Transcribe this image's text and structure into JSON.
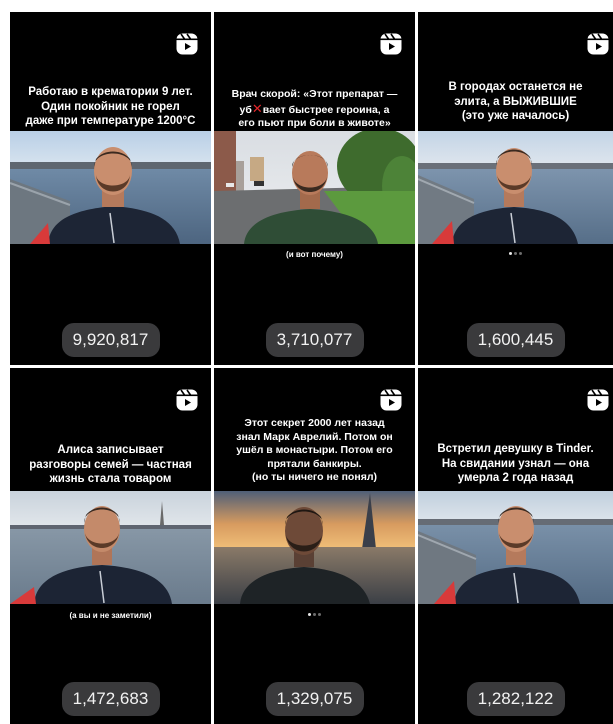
{
  "reels": [
    {
      "caption": "Работаю в крематории 9 лет.\nОдин покойник не горел\nдаже при температуре 1200°C",
      "views": "9,920,817"
    },
    {
      "caption_part1": "Врач скорой: «Этот препарат —\nуб",
      "caption_mark": "✕",
      "caption_part2": "вает быстрее героина, а\nего пьют при боли в животе»",
      "subtext": "(и вот почему)",
      "views": "3,710,077"
    },
    {
      "caption": "В городах останется не\nэлита, а ВЫЖИВШИЕ\n(это уже началось)",
      "views": "1,600,445"
    },
    {
      "caption": "Алиса записывает\nразговоры семей — частная\nжизнь стала товаром",
      "subtext": "(а вы и не заметили)",
      "views": "1,472,683"
    },
    {
      "caption": "Этот секрет 2000 лет назад\nзнал Марк Аврелий. Потом он\nушёл в монастыри. Потом его\nпрятали банкиры.\n(но ты ничего не понял)",
      "views": "1,329,075"
    },
    {
      "caption": "Встретил девушку в Tinder.\nНа свидании узнал — она\nумерла 2 года назад",
      "views": "1,282,122"
    }
  ],
  "icons": {
    "reel": "reels-icon"
  },
  "colors": {
    "tile_bg": "#000000",
    "views_pill": "#3a3a3c",
    "accent_red": "#e3262b"
  }
}
